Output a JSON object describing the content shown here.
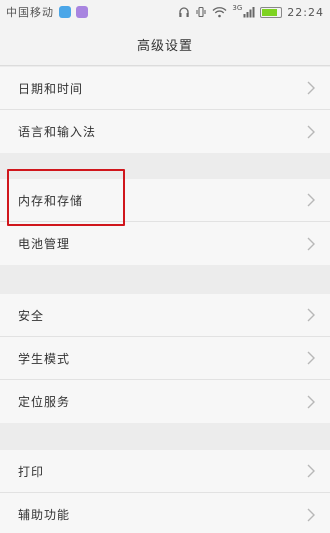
{
  "status_bar": {
    "carrier": "中国移动",
    "network": "3G",
    "time": "22:24",
    "battery_level": 0.8
  },
  "header": {
    "title": "高级设置"
  },
  "groups": [
    {
      "items": [
        {
          "label": "日期和时间"
        },
        {
          "label": "语言和输入法"
        }
      ]
    },
    {
      "items": [
        {
          "label": "内存和存储"
        },
        {
          "label": "电池管理"
        }
      ]
    },
    {
      "items": [
        {
          "label": "安全"
        },
        {
          "label": "学生模式"
        },
        {
          "label": "定位服务"
        }
      ]
    },
    {
      "items": [
        {
          "label": "打印"
        },
        {
          "label": "辅助功能"
        }
      ]
    }
  ],
  "highlighted_item": "内存和存储",
  "colors": {
    "highlight": "#d0161c",
    "background": "#ececec",
    "row": "#f7f7f7"
  }
}
